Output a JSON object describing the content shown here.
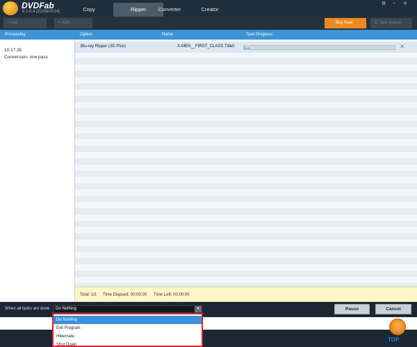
{
  "header": {
    "brand": "DVDFab",
    "version": "9.1.6.4 (21/08/2014)",
    "tabs": [
      "Copy",
      "Ripper",
      "Converter",
      "Creator"
    ],
    "active_tab": "Ripper",
    "window_controls": [
      "settings-icon",
      "minimize-icon",
      "close-icon"
    ]
  },
  "toolbar": {
    "add_label": "Add",
    "edit_label": "Edit",
    "buy_label": "Buy Now",
    "task_queue_label": "Task Queue"
  },
  "columns": {
    "processing": "Processing",
    "option": "Option",
    "name": "Name",
    "progress": "Task Progress"
  },
  "processing": {
    "time": "10:17:35",
    "conversion": "Conversion: one pass"
  },
  "task": {
    "option": "Blu-ray Ripper (3D Plus)",
    "name": "X-MEN__FIRST_CLASS.Title0",
    "progress_text": "0%",
    "progress": 0
  },
  "summary": {
    "total": "Total: 1/1",
    "elapsed": "Time Elapsed: 00:00:00",
    "left": "Time Left: 00:00:00"
  },
  "bottom": {
    "when_label": "When all tasks are done",
    "selected": "Do Nothing",
    "pause_label": "Pause",
    "cancel_label": "Cancel"
  },
  "dropdown": {
    "options": [
      "Do Nothing",
      "Exit Program",
      "Hibernate",
      "Shut Down"
    ],
    "highlighted": "Do Nothing"
  },
  "footer": {
    "top_label": "TOP"
  },
  "colors": {
    "accent": "#3d94d6",
    "buy": "#f0891d",
    "highlight_border": "#e21f2b"
  }
}
